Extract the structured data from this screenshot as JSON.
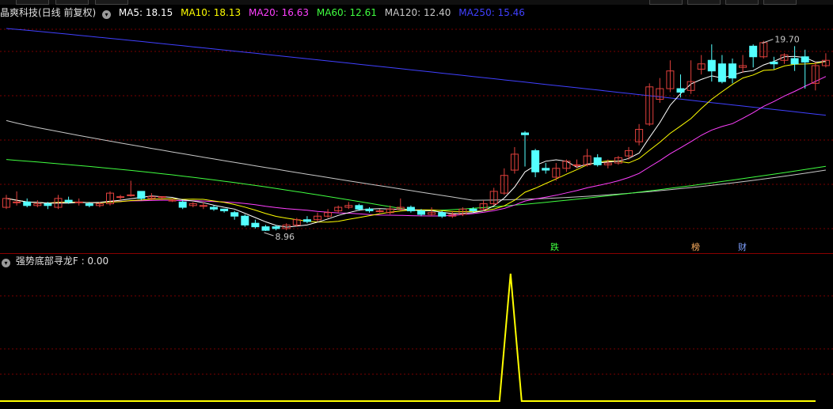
{
  "colors": {
    "background": "#000000",
    "grid": "#7a0000",
    "candle_up": "#e0403c",
    "candle_down": "#54ffff",
    "ma5": "#ffffff",
    "ma10": "#ffff00",
    "ma20": "#ff40ff",
    "ma60": "#40ff40",
    "ma120": "#c8c8c8",
    "ma250": "#4040ff",
    "indicator_line": "#ffff00"
  },
  "header": {
    "stock_name": "晶爽科技(日线 前复权)",
    "ma_values": [
      {
        "label": "MA5: 18.15",
        "color": "#ffffff"
      },
      {
        "label": "MA10: 18.13",
        "color": "#ffff00"
      },
      {
        "label": "MA20: 16.63",
        "color": "#ff40ff"
      },
      {
        "label": "MA60: 12.61",
        "color": "#40ff40"
      },
      {
        "label": "MA120: 12.40",
        "color": "#c8c8c8"
      },
      {
        "label": "MA250: 15.46",
        "color": "#4040ff"
      }
    ]
  },
  "annotations": {
    "high_label": "19.70",
    "low_label": "8.96",
    "markers": [
      {
        "text": "跌",
        "color": "#40ff40"
      },
      {
        "text": "榜",
        "color": "#ffb060"
      },
      {
        "text": "财",
        "color": "#7fa0ff"
      }
    ]
  },
  "indicator": {
    "name": "强势底部寻龙F",
    "value_label": ": 0.00"
  },
  "chart_data": {
    "type": "candlestick",
    "price_range": [
      7.8,
      20.8
    ],
    "high_value": 19.7,
    "low_value": 8.96,
    "candles": [
      [
        10.3,
        10.8,
        10.2,
        11.0
      ],
      [
        10.6,
        10.6,
        10.4,
        11.2
      ],
      [
        10.6,
        10.4,
        10.3,
        10.8
      ],
      [
        10.4,
        10.5,
        10.3,
        10.7
      ],
      [
        10.5,
        10.4,
        10.2,
        10.6
      ],
      [
        10.3,
        10.8,
        10.2,
        11.0
      ],
      [
        10.7,
        10.6,
        10.5,
        10.9
      ],
      [
        10.6,
        10.6,
        10.4,
        10.8
      ],
      [
        10.5,
        10.4,
        10.3,
        10.6
      ],
      [
        10.4,
        10.5,
        10.3,
        10.6
      ],
      [
        10.5,
        11.1,
        10.4,
        11.2
      ],
      [
        10.9,
        10.9,
        10.7,
        11.0
      ],
      [
        11.0,
        11.0,
        10.9,
        11.8
      ],
      [
        11.2,
        10.8,
        10.7,
        11.2
      ],
      [
        10.8,
        10.9,
        10.7,
        11.1
      ],
      [
        10.9,
        10.9,
        10.7,
        10.9
      ],
      [
        10.7,
        10.7,
        10.6,
        10.8
      ],
      [
        10.6,
        10.3,
        10.2,
        10.7
      ],
      [
        10.4,
        10.5,
        10.3,
        10.6
      ],
      [
        10.4,
        10.4,
        10.2,
        10.6
      ],
      [
        10.3,
        10.2,
        10.1,
        10.4
      ],
      [
        10.2,
        10.1,
        10.0,
        10.2
      ],
      [
        10.0,
        9.8,
        9.6,
        10.1
      ],
      [
        9.8,
        9.3,
        9.2,
        9.9
      ],
      [
        9.4,
        9.2,
        9.1,
        9.6
      ],
      [
        9.2,
        9.0,
        8.96,
        9.3
      ],
      [
        9.2,
        9.1,
        9.0,
        9.3
      ],
      [
        9.1,
        9.3,
        9.0,
        9.4
      ],
      [
        9.3,
        9.6,
        9.2,
        9.7
      ],
      [
        9.6,
        9.5,
        9.4,
        9.8
      ],
      [
        9.6,
        9.8,
        9.5,
        10.0
      ],
      [
        9.8,
        10.0,
        9.7,
        10.2
      ],
      [
        10.1,
        10.3,
        10.0,
        10.4
      ],
      [
        10.3,
        10.4,
        10.2,
        10.6
      ],
      [
        10.4,
        10.2,
        10.1,
        10.5
      ],
      [
        10.2,
        10.1,
        10.0,
        10.3
      ],
      [
        10.1,
        10.1,
        10.0,
        10.2
      ],
      [
        10.0,
        10.2,
        9.9,
        10.4
      ],
      [
        10.2,
        10.3,
        10.1,
        10.8
      ],
      [
        10.3,
        10.1,
        10.0,
        10.4
      ],
      [
        10.1,
        9.9,
        9.8,
        10.2
      ],
      [
        9.9,
        10.0,
        9.8,
        10.3
      ],
      [
        10.0,
        9.8,
        9.7,
        10.1
      ],
      [
        9.8,
        9.9,
        9.7,
        10.1
      ],
      [
        9.9,
        10.2,
        9.8,
        10.3
      ],
      [
        10.2,
        10.1,
        10.0,
        10.3
      ],
      [
        10.2,
        10.5,
        10.1,
        10.7
      ],
      [
        10.5,
        11.2,
        10.4,
        11.4
      ],
      [
        11.1,
        12.1,
        11.0,
        12.5
      ],
      [
        12.4,
        13.3,
        12.2,
        13.7
      ],
      [
        14.5,
        14.4,
        12.6,
        14.6
      ],
      [
        13.5,
        12.3,
        12.0,
        13.6
      ],
      [
        12.5,
        12.4,
        12.2,
        12.8
      ],
      [
        12.0,
        12.5,
        11.8,
        12.8
      ],
      [
        12.5,
        12.9,
        12.3,
        13.0
      ],
      [
        12.7,
        12.7,
        12.5,
        13.0
      ],
      [
        12.7,
        13.2,
        12.6,
        13.6
      ],
      [
        13.1,
        12.7,
        12.6,
        13.3
      ],
      [
        12.7,
        12.8,
        12.5,
        13.0
      ],
      [
        12.8,
        13.1,
        12.7,
        13.2
      ],
      [
        13.2,
        13.5,
        13.0,
        13.7
      ],
      [
        14.0,
        14.7,
        13.8,
        15.0
      ],
      [
        15.0,
        17.1,
        14.9,
        17.3
      ],
      [
        16.4,
        17.0,
        16.2,
        17.6
      ],
      [
        17.0,
        18.0,
        16.8,
        18.6
      ],
      [
        17.0,
        16.8,
        16.5,
        17.8
      ],
      [
        16.9,
        17.4,
        16.7,
        18.6
      ],
      [
        18.1,
        18.4,
        17.8,
        18.9
      ],
      [
        18.6,
        18.0,
        17.4,
        19.5
      ],
      [
        18.4,
        17.4,
        17.3,
        18.9
      ],
      [
        18.4,
        17.6,
        17.3,
        18.7
      ],
      [
        18.2,
        18.3,
        17.9,
        18.9
      ],
      [
        19.4,
        18.8,
        18.2,
        19.5
      ],
      [
        18.8,
        19.6,
        18.7,
        19.7
      ],
      [
        18.5,
        18.4,
        18.1,
        18.8
      ],
      [
        18.6,
        18.9,
        18.4,
        19.0
      ],
      [
        18.7,
        18.4,
        18.0,
        19.4
      ],
      [
        18.8,
        18.5,
        17.0,
        19.2
      ],
      [
        17.3,
        18.3,
        16.9,
        18.5
      ],
      [
        18.3,
        18.6,
        18.2,
        19.0
      ]
    ],
    "indicator": {
      "name": "强势底部寻龙F",
      "last_value": 0.0,
      "spike_index": 48,
      "spike_value": 1.0,
      "range": [
        0,
        1.05
      ]
    }
  }
}
